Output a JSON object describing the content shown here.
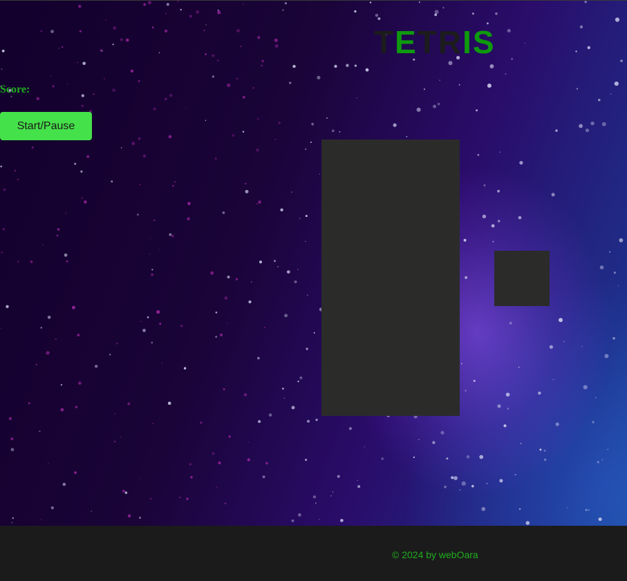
{
  "header": {
    "title_letters": [
      "T",
      "E",
      "T",
      "R",
      "I",
      "S"
    ],
    "title_letter_styles": [
      "dark",
      "green",
      "dark",
      "dark",
      "green",
      "green"
    ]
  },
  "sidebar": {
    "score_label": "Score:",
    "start_pause_label": "Start/Pause"
  },
  "footer": {
    "copyright": "© 2024 by webOara"
  },
  "colors": {
    "accent_green": "#1fae1f",
    "button_green": "#45e14a",
    "board_bg": "#2b2b2a",
    "footer_bg": "#1b1b1b"
  }
}
